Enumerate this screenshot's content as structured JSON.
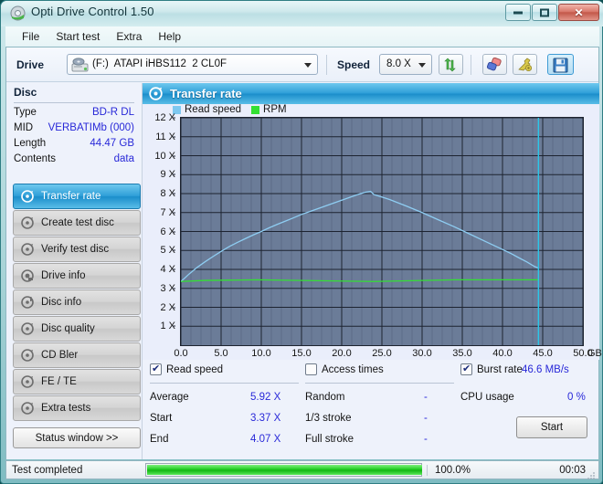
{
  "window": {
    "title": "Opti Drive Control 1.50",
    "icon": "disc-icon",
    "buttons": {
      "minimize": "minimize-icon",
      "maximize": "maximize-icon",
      "close": "close-icon"
    }
  },
  "menu": {
    "items": [
      "File",
      "Start test",
      "Extra",
      "Help"
    ]
  },
  "toolbar": {
    "drive_label": "Drive",
    "drive_value": "(F:)  ATAPI iHBS112  2 CL0F",
    "speed_label": "Speed",
    "speed_value": "8.0 X",
    "refresh_icon": "refresh-arrows-icon",
    "erase_icon": "eraser-icon",
    "tools_icon": "wrench-icon",
    "save_icon": "save-floppy-icon"
  },
  "disc": {
    "header": "Disc",
    "rows": [
      {
        "key": "Type",
        "value": "BD-R DL"
      },
      {
        "key": "MID",
        "value": "VERBATIMb (000)"
      },
      {
        "key": "Length",
        "value": "44.47 GB"
      },
      {
        "key": "Contents",
        "value": "data"
      }
    ]
  },
  "nav": {
    "items": [
      {
        "label": "Transfer rate",
        "icon": "disc-speed-icon",
        "active": true
      },
      {
        "label": "Create test disc",
        "icon": "disc-burn-icon",
        "active": false
      },
      {
        "label": "Verify test disc",
        "icon": "disc-verify-icon",
        "active": false
      },
      {
        "label": "Drive info",
        "icon": "drive-info-icon",
        "active": false
      },
      {
        "label": "Disc info",
        "icon": "disc-info-icon",
        "active": false
      },
      {
        "label": "Disc quality",
        "icon": "disc-quality-icon",
        "active": false
      },
      {
        "label": "CD Bler",
        "icon": "disc-bler-icon",
        "active": false
      },
      {
        "label": "FE / TE",
        "icon": "disc-fete-icon",
        "active": false
      },
      {
        "label": "Extra tests",
        "icon": "disc-extra-icon",
        "active": false
      }
    ],
    "status_window_label": "Status window >>"
  },
  "panel": {
    "title": "Transfer rate",
    "icon": "disc-speed-icon"
  },
  "chart_data": {
    "type": "line",
    "title": "Transfer rate",
    "xlabel": "GB",
    "ylabel": "X",
    "xlim": [
      0.0,
      50.0
    ],
    "ylim": [
      0.0,
      12.0
    ],
    "xticks": [
      0.0,
      5.0,
      10.0,
      15.0,
      20.0,
      25.0,
      30.0,
      35.0,
      40.0,
      45.0,
      50.0
    ],
    "xtick_labels": [
      "0.0",
      "5.0",
      "10.0",
      "15.0",
      "20.0",
      "25.0",
      "30.0",
      "35.0",
      "40.0",
      "45.0",
      "50.0"
    ],
    "x_unit_label": "GB",
    "yticks": [
      1,
      2,
      3,
      4,
      5,
      6,
      7,
      8,
      9,
      10,
      11,
      12
    ],
    "ytick_labels": [
      "1 X",
      "2 X",
      "3 X",
      "4 X",
      "5 X",
      "6 X",
      "7 X",
      "8 X",
      "9 X",
      "10 X",
      "11 X",
      "12 X"
    ],
    "grid": true,
    "legend": [
      {
        "name": "Read speed",
        "color": "#7ec8f0"
      },
      {
        "name": "RPM",
        "color": "#33e033"
      }
    ],
    "legend_position": "top-left",
    "plot_bg": "#6b7c98",
    "series": [
      {
        "name": "Read speed",
        "color": "#8ecdf2",
        "x": [
          0.0,
          0.5,
          1.0,
          2.0,
          3.0,
          4.0,
          5.0,
          6.0,
          7.0,
          8.0,
          9.0,
          10.0,
          11.0,
          12.0,
          13.0,
          14.0,
          15.0,
          16.0,
          17.0,
          18.0,
          19.0,
          20.0,
          21.0,
          22.0,
          23.0,
          23.6,
          24.0,
          25.0,
          26.0,
          28.0,
          30.0,
          32.0,
          34.0,
          36.0,
          38.0,
          40.0,
          41.0,
          42.0,
          43.0,
          44.0,
          44.47
        ],
        "y": [
          3.37,
          3.55,
          3.75,
          4.1,
          4.4,
          4.68,
          4.95,
          5.2,
          5.42,
          5.62,
          5.82,
          6.0,
          6.2,
          6.38,
          6.55,
          6.72,
          6.9,
          7.05,
          7.2,
          7.35,
          7.5,
          7.65,
          7.8,
          7.95,
          8.08,
          8.12,
          7.95,
          7.82,
          7.68,
          7.35,
          7.0,
          6.62,
          6.25,
          5.85,
          5.45,
          5.05,
          4.85,
          4.62,
          4.4,
          4.15,
          4.07
        ]
      },
      {
        "name": "RPM",
        "color": "#33e033",
        "x": [
          0.0,
          3.0,
          9.5,
          24.0,
          34.0,
          44.47
        ],
        "y": [
          3.36,
          3.42,
          3.45,
          3.36,
          3.45,
          3.45
        ]
      }
    ],
    "markers": [
      {
        "type": "vline",
        "x": 44.47,
        "color": "#2ac6e8"
      }
    ]
  },
  "results": {
    "read_speed": {
      "checkbox_label": "Read speed",
      "checked": true,
      "rows": [
        {
          "key": "Average",
          "value": "5.92 X"
        },
        {
          "key": "Start",
          "value": "3.37 X"
        },
        {
          "key": "End",
          "value": "4.07 X"
        }
      ]
    },
    "access_times": {
      "checkbox_label": "Access times",
      "checked": false,
      "rows": [
        {
          "key": "Random",
          "value": "-"
        },
        {
          "key": "1/3 stroke",
          "value": "-"
        },
        {
          "key": "Full stroke",
          "value": "-"
        }
      ]
    },
    "burst": {
      "checkbox_label": "Burst rate",
      "checked": true,
      "burst_value": "46.6 MB/s",
      "cpu_key": "CPU usage",
      "cpu_value": "0 %"
    },
    "start_button": "Start"
  },
  "statusbar": {
    "message": "Test completed",
    "progress_percent": 100.0,
    "progress_label": "100.0%",
    "elapsed": "00:03"
  }
}
